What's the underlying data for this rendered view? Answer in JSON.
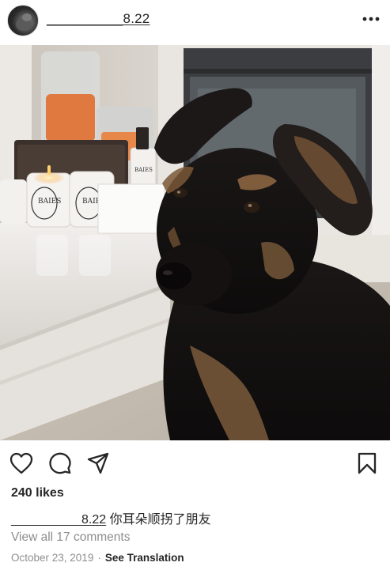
{
  "post": {
    "username": "__________8.22",
    "caption_user": "__________8.22",
    "caption_text": "你耳朵顺拐了朋友",
    "likes": "240 likes",
    "view_comments": "View all 17 comments",
    "date": "October 23, 2019",
    "separator": "·",
    "see_translation": "See Translation"
  },
  "photo": {
    "candle_labels": [
      "BAIES",
      "BAIES",
      "BAIES"
    ]
  },
  "icons": {
    "more": "more-options-icon",
    "like": "heart-icon",
    "comment": "comment-bubble-icon",
    "share": "send-plane-icon",
    "save": "bookmark-icon"
  }
}
